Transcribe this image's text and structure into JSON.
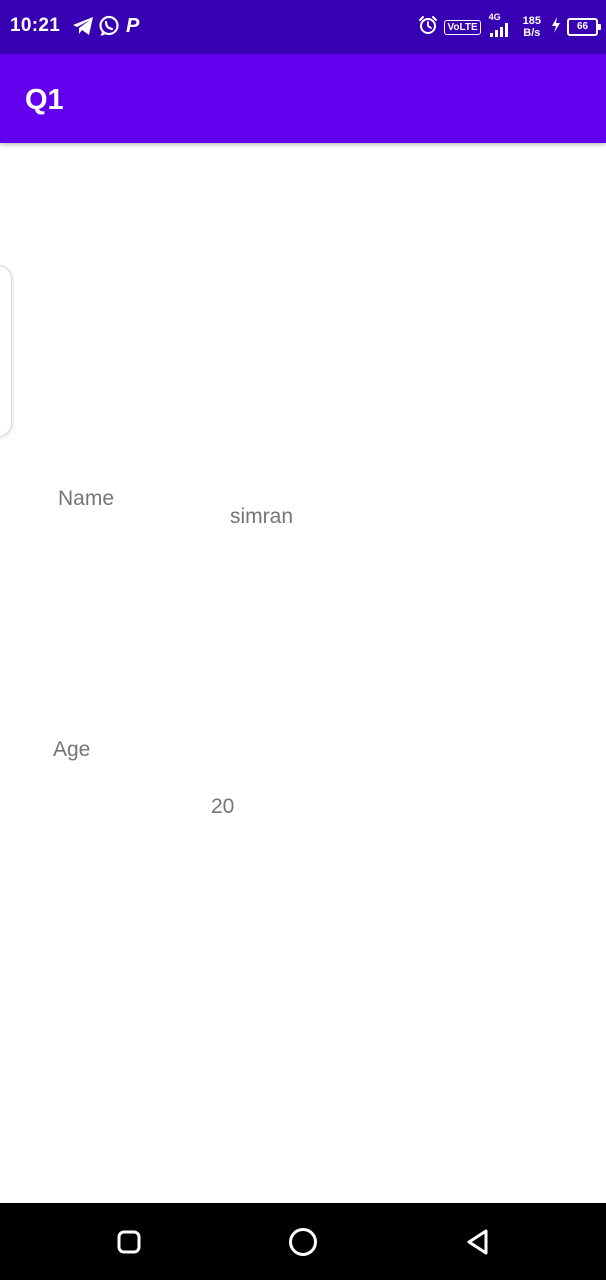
{
  "status_bar": {
    "time": "10:21",
    "left_icons": [
      "telegram-icon",
      "whatsapp-icon",
      "paytm-p-icon"
    ],
    "p_glyph": "P",
    "alarm_icon": "alarm-icon",
    "network_type": "4G",
    "volte": "VoLTE",
    "signal_icon": "signal-icon",
    "net_speed_value": "185",
    "net_speed_unit": "B/s",
    "battery_level": "66",
    "charging_icon": "charging-bolt-icon",
    "colors": {
      "background": "#3700b3",
      "foreground": "#ffffff"
    }
  },
  "app_bar": {
    "title": "Q1",
    "color": "#6200ee"
  },
  "fields": {
    "name_label": "Name",
    "name_value": "simran",
    "age_label": "Age",
    "age_value": "20"
  },
  "nav_bar": {
    "recents_icon": "recents-square-icon",
    "home_icon": "home-circle-icon",
    "back_icon": "back-triangle-icon",
    "color": "#000000"
  }
}
